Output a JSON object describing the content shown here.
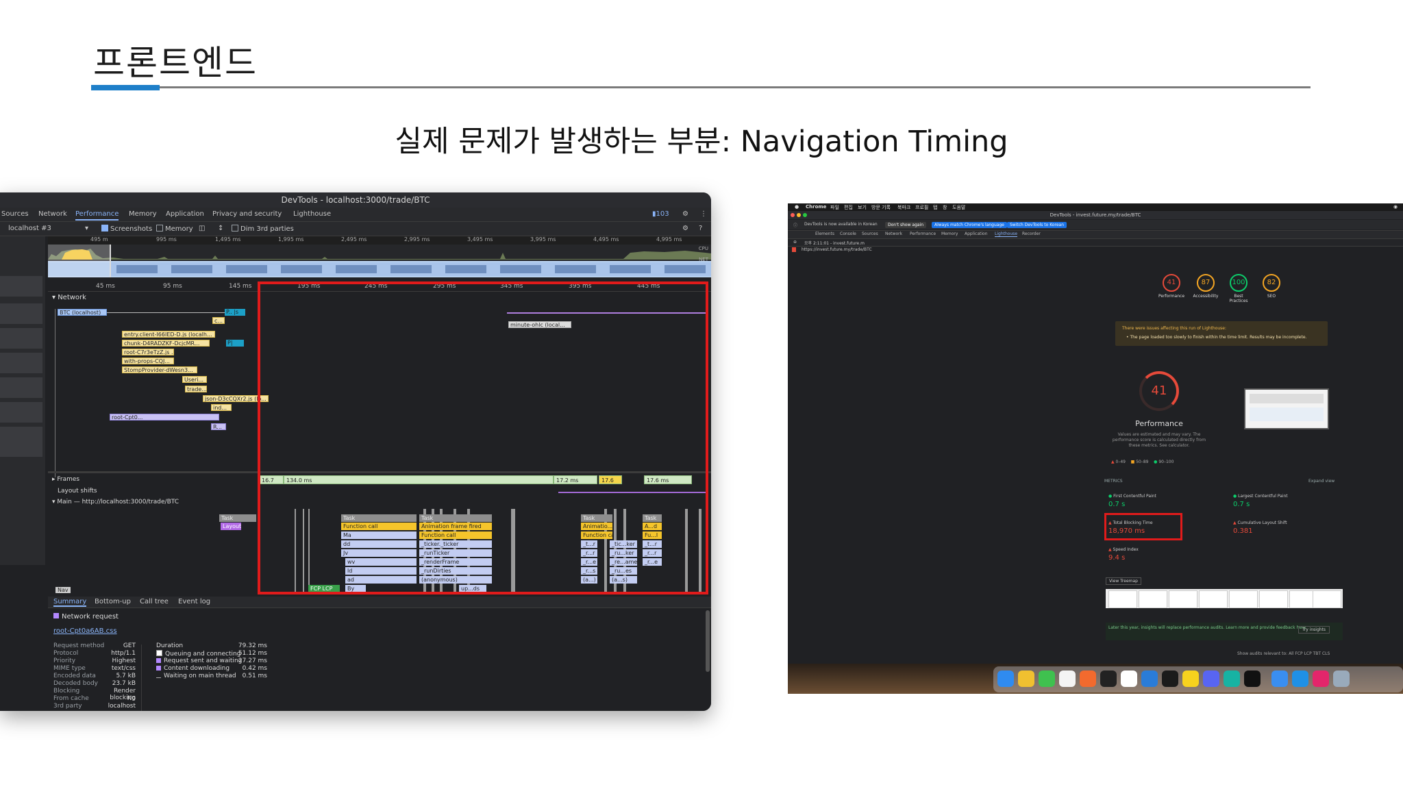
{
  "slide": {
    "title": "프론트엔드",
    "subtitle": "실제 문제가 발생하는 부분: Navigation Timing",
    "accent_color": "#1e7fc9",
    "highlight_color": "#e11b1b"
  },
  "devtools": {
    "window_title": "DevTools - localhost:3000/trade/BTC",
    "tabs": [
      "Sources",
      "Network",
      "Performance",
      "Memory",
      "Application",
      "Privacy and security",
      "Lighthouse"
    ],
    "active_tab": "Performance",
    "issues_count": "103",
    "toolbar": {
      "target": "localhost #3",
      "screenshots_label": "Screenshots",
      "memory_label": "Memory",
      "dim_label": "Dim 3rd parties"
    },
    "overview_ticks": [
      "495 m",
      "995 ms",
      "1,495 ms",
      "1,995 ms",
      "2,495 ms",
      "2,995 ms",
      "3,495 ms",
      "3,995 ms",
      "4,495 ms",
      "4,995 ms"
    ],
    "overview_labels": {
      "cpu": "CPU",
      "net": "NET"
    },
    "ms_ticks": [
      "45 ms",
      "95 ms",
      "145 ms",
      "195 ms",
      "245 ms",
      "295 ms",
      "345 ms",
      "395 ms",
      "445 ms"
    ],
    "network_label": "Network",
    "waterfall": [
      "BTC (localhost)",
      "P.. |s",
      "c...",
      "entry.client-I66IED-D.js (localh...",
      "chunk-D4RADZKF-DcjcMR...",
      "P|",
      "root-C7r3eTzZ.js ...",
      "with-props-CQJ...",
      "StompProvider-dWesn3...",
      "Useri...",
      "trade...",
      "json-D3cCQXr2.js (lo...",
      "ind...",
      "root-Cpt0...",
      "R...",
      "minute-ohlc (local..."
    ],
    "frames_label": "Frames",
    "frames": [
      "16.7 ms",
      "134.0 ms",
      "17.2 ms",
      "17.6 ms",
      "17.6 ms"
    ],
    "layout_shifts_label": "Layout shifts",
    "main_label": "Main — http://localhost:3000/trade/BTC",
    "flame": {
      "task": "Task",
      "layout": "Layout",
      "col1": [
        "Function call",
        "Ma",
        "dd",
        "Jv",
        "wv",
        "ld",
        "ad",
        "By"
      ],
      "col2": [
        "Animation frame fired",
        "Function call",
        "_ticker._ticker",
        "_runTicker",
        "_renderFrame",
        "_runDirties",
        "(anonymous)",
        "up...ds"
      ],
      "col3": [
        "Animatio...me fired",
        "Function call",
        "_t...r",
        "_r...r",
        "_r...e",
        "_r...s",
        "(a...)"
      ],
      "col4": [
        "_tic...ker",
        "_ru...ker",
        "_re...ame",
        "_ru...es",
        "(a...s)"
      ],
      "col5": [
        "A...d",
        "Fu...l",
        "_t...r",
        "_r...r",
        "_r...e"
      ],
      "nav": "Nav",
      "fcp": "FCP LCP"
    },
    "summary_tabs": [
      "Summary",
      "Bottom-up",
      "Call tree",
      "Event log"
    ],
    "summary": {
      "type": "Network request",
      "file": "root-Cpt0a6AB.css",
      "props": [
        {
          "k": "Request method",
          "v": "GET"
        },
        {
          "k": "Protocol",
          "v": "http/1.1"
        },
        {
          "k": "Priority",
          "v": "Highest"
        },
        {
          "k": "MIME type",
          "v": "text/css"
        },
        {
          "k": "Encoded data",
          "v": "5.7 kB"
        },
        {
          "k": "Decoded body",
          "v": "23.7 kB"
        },
        {
          "k": "Blocking",
          "v": "Render blocking"
        },
        {
          "k": "From cache",
          "v": "No"
        },
        {
          "k": "3rd party",
          "v": "localhost"
        }
      ],
      "timing": [
        {
          "k": "Duration",
          "v": "79.32 ms"
        },
        {
          "k": "Queuing and connecting",
          "v": "51.12 ms"
        },
        {
          "k": "Request sent and waiting",
          "v": "27.27 ms"
        },
        {
          "k": "Content downloading",
          "v": "0.42 ms"
        },
        {
          "k": "Waiting on main thread",
          "v": "0.51 ms"
        }
      ]
    }
  },
  "lighthouse": {
    "menubar": [
      "Chrome",
      "파일",
      "편집",
      "보기",
      "방문 기록",
      "북마크",
      "프로필",
      "탭",
      "창",
      "도움말"
    ],
    "window_title": "DevTools - invest.future.my/trade/BTC",
    "notice": {
      "text": "DevTools is now available in Korean",
      "dont_show": "Don't show again",
      "always_match": "Always match Chrome's language",
      "switch": "Switch DevTools to Korean"
    },
    "tabs": [
      "Elements",
      "Console",
      "Sources",
      "Network",
      "Performance",
      "Memory",
      "Application",
      "Lighthouse",
      "Recorder"
    ],
    "run_label": "오후 2:11:01 - invest.future.m",
    "url": "https://invest.future.my/trade/BTC",
    "scores": [
      {
        "name": "Performance",
        "value": "41",
        "color": "#e64a3a"
      },
      {
        "name": "Accessibility",
        "value": "87",
        "color": "#f5a623"
      },
      {
        "name": "Best Practices",
        "value": "100",
        "color": "#0cce6b"
      },
      {
        "name": "SEO",
        "value": "82",
        "color": "#f5a623"
      }
    ],
    "warning_title": "There were issues affecting this run of Lighthouse:",
    "warning_body": "• The page loaded too slowly to finish within the time limit. Results may be incomplete.",
    "perf_score": "41",
    "perf_title": "Performance",
    "perf_desc": "Values are estimated and may vary. The performance score is calculated directly from these metrics. See calculator.",
    "legend": [
      "0–49",
      "50–89",
      "90–100"
    ],
    "metrics_label": "METRICS",
    "expand_view": "Expand view",
    "metrics": [
      {
        "name": "First Contentful Paint",
        "value": "0.7 s",
        "status": "good"
      },
      {
        "name": "Largest Contentful Paint",
        "value": "0.7 s",
        "status": "good"
      },
      {
        "name": "Total Blocking Time",
        "value": "18,970 ms",
        "status": "poor"
      },
      {
        "name": "Cumulative Layout Shift",
        "value": "0.381",
        "status": "poor"
      },
      {
        "name": "Speed Index",
        "value": "9.4 s",
        "status": "poor"
      }
    ],
    "view_treemap": "View Treemap",
    "insight_text": "Later this year, insights will replace performance audits. Learn more and provide feedback here.",
    "try_insights": "Try insights",
    "audits_row": "Show audits relevant to: All FCP LCP TBT CLS"
  }
}
